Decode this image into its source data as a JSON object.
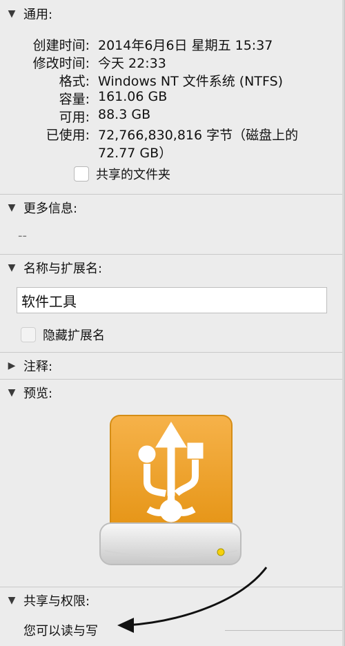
{
  "general": {
    "title": "通用:",
    "created_label": "创建时间:",
    "created_value": "2014年6月6日 星期五 15:37",
    "modified_label": "修改时间:",
    "modified_value": "今天 22:33",
    "format_label": "格式:",
    "format_value": "Windows NT 文件系统 (NTFS)",
    "capacity_label": "容量:",
    "capacity_value": "161.06 GB",
    "available_label": "可用:",
    "available_value": "88.3 GB",
    "used_label": "已使用:",
    "used_value_line1": "72,766,830,816 字节（磁盘上的",
    "used_value_line2": "72.77 GB）",
    "shared_folder_label": "共享的文件夹"
  },
  "more_info": {
    "title": "更多信息:",
    "placeholder": "--"
  },
  "name_ext": {
    "title": "名称与扩展名:",
    "name_value": "软件工具",
    "hide_ext_label": "隐藏扩展名"
  },
  "comments": {
    "title": "注释:"
  },
  "preview": {
    "title": "预览:"
  },
  "sharing": {
    "title": "共享与权限:",
    "permission_text": "您可以读与写"
  }
}
